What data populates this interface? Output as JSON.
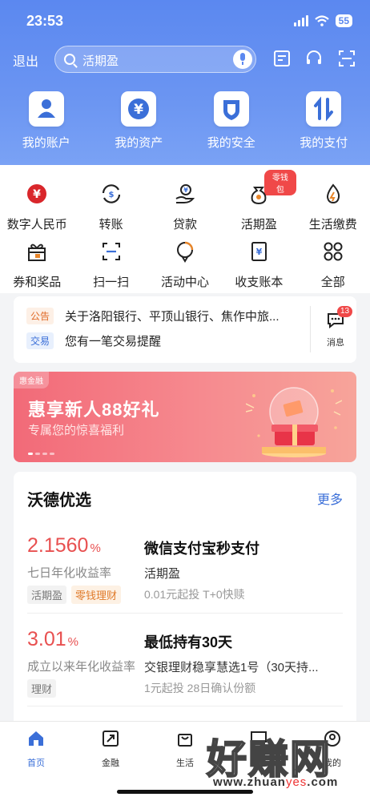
{
  "status_bar": {
    "time": "23:53",
    "battery": "55"
  },
  "header": {
    "logout_label": "退出",
    "search_text": "活期盈",
    "quick_items": [
      {
        "label": "我的账户",
        "icon": "user-icon"
      },
      {
        "label": "我的资产",
        "icon": "yuan-icon"
      },
      {
        "label": "我的安全",
        "icon": "shield-icon"
      },
      {
        "label": "我的支付",
        "icon": "transfer-arrows-icon"
      }
    ]
  },
  "services": [
    {
      "label": "数字人民币",
      "icon": "digital-rmb-icon"
    },
    {
      "label": "转账",
      "icon": "transfer-icon"
    },
    {
      "label": "贷款",
      "icon": "loan-icon"
    },
    {
      "label": "活期盈",
      "icon": "money-bag-icon",
      "badge": "零钱包"
    },
    {
      "label": "生活缴费",
      "icon": "flame-icon"
    },
    {
      "label": "券和奖品",
      "icon": "gift-icon"
    },
    {
      "label": "扫一扫",
      "icon": "scan-icon"
    },
    {
      "label": "活动中心",
      "icon": "activity-icon"
    },
    {
      "label": "收支账本",
      "icon": "ledger-icon"
    },
    {
      "label": "全部",
      "icon": "grid-icon"
    }
  ],
  "notice": {
    "items": [
      {
        "tag": "公告",
        "text": "关于洛阳银行、平顶山银行、焦作中旅..."
      },
      {
        "tag": "交易",
        "text": "您有一笔交易提醒"
      }
    ],
    "message_label": "消息",
    "message_count": "13"
  },
  "banner": {
    "brand": "惠金融",
    "title": "惠享新人88好礼",
    "subtitle": "专属您的惊喜福利"
  },
  "recommend": {
    "title": "沃德优选",
    "more": "更多",
    "products": [
      {
        "rate": "2.1560",
        "rate_unit": "%",
        "rate_desc": "七日年化收益率",
        "tags": [
          "活期盈",
          "零钱理财"
        ],
        "name": "微信支付宝秒支付",
        "sub": "活期盈",
        "info": "0.01元起投 T+0快赎"
      },
      {
        "rate": "3.01",
        "rate_unit": "%",
        "rate_desc": "成立以来年化收益率",
        "tags": [
          "理财"
        ],
        "name": "最低持有30天",
        "sub": "交银理财稳享慧选1号（30天持...",
        "info": "1元起投 28日确认份额"
      }
    ]
  },
  "bottom_nav": [
    {
      "label": "首页",
      "icon": "home-icon",
      "active": true
    },
    {
      "label": "金融",
      "icon": "finance-icon"
    },
    {
      "label": "生活",
      "icon": "shopping-bag-icon"
    },
    {
      "label": "社区",
      "icon": "chat-icon"
    },
    {
      "label": "我的",
      "icon": "profile-icon"
    }
  ],
  "watermark": {
    "text": "好赚网",
    "url_prefix": "www.zhuan",
    "url_accent": "yes",
    "url_suffix": ".com"
  },
  "colors": {
    "primary": "#5b88f0",
    "accent_red": "#e85050",
    "link_blue": "#3b6fd8"
  }
}
